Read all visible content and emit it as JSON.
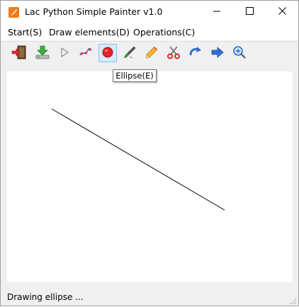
{
  "window": {
    "title": "Lac Python Simple Painter v1.0",
    "icon": "app-icon-orange",
    "controls": [
      "minimize-icon",
      "maximize-icon",
      "close-icon"
    ]
  },
  "menu": {
    "items": [
      {
        "label": "Start(S)"
      },
      {
        "label": "Draw elements(D)"
      },
      {
        "label": "Operations(C)"
      }
    ]
  },
  "toolbar": {
    "tools": [
      {
        "name": "exit",
        "icon": "exit-door-icon"
      },
      {
        "name": "save",
        "icon": "download-save-icon"
      },
      {
        "name": "play",
        "icon": "play-triangle-icon"
      },
      {
        "name": "curve",
        "icon": "curve-line-icon"
      },
      {
        "name": "ellipse",
        "icon": "red-circle-icon",
        "active": true
      },
      {
        "name": "brush",
        "icon": "brush-icon"
      },
      {
        "name": "pencil",
        "icon": "pencil-icon"
      },
      {
        "name": "cut",
        "icon": "scissors-icon"
      },
      {
        "name": "redo",
        "icon": "redo-arrow-icon"
      },
      {
        "name": "forward",
        "icon": "forward-arrow-icon"
      },
      {
        "name": "zoom",
        "icon": "zoom-in-icon"
      }
    ],
    "tooltip": "Ellipse(E)"
  },
  "canvas": {
    "background": "#ffffff",
    "stroke_color": "#000000"
  },
  "status": {
    "text": "Drawing ellipse ..."
  },
  "colors": {
    "accent": "#2f7fd0",
    "icon_red": "#e0262b",
    "app_icon": "#f07a1a"
  }
}
